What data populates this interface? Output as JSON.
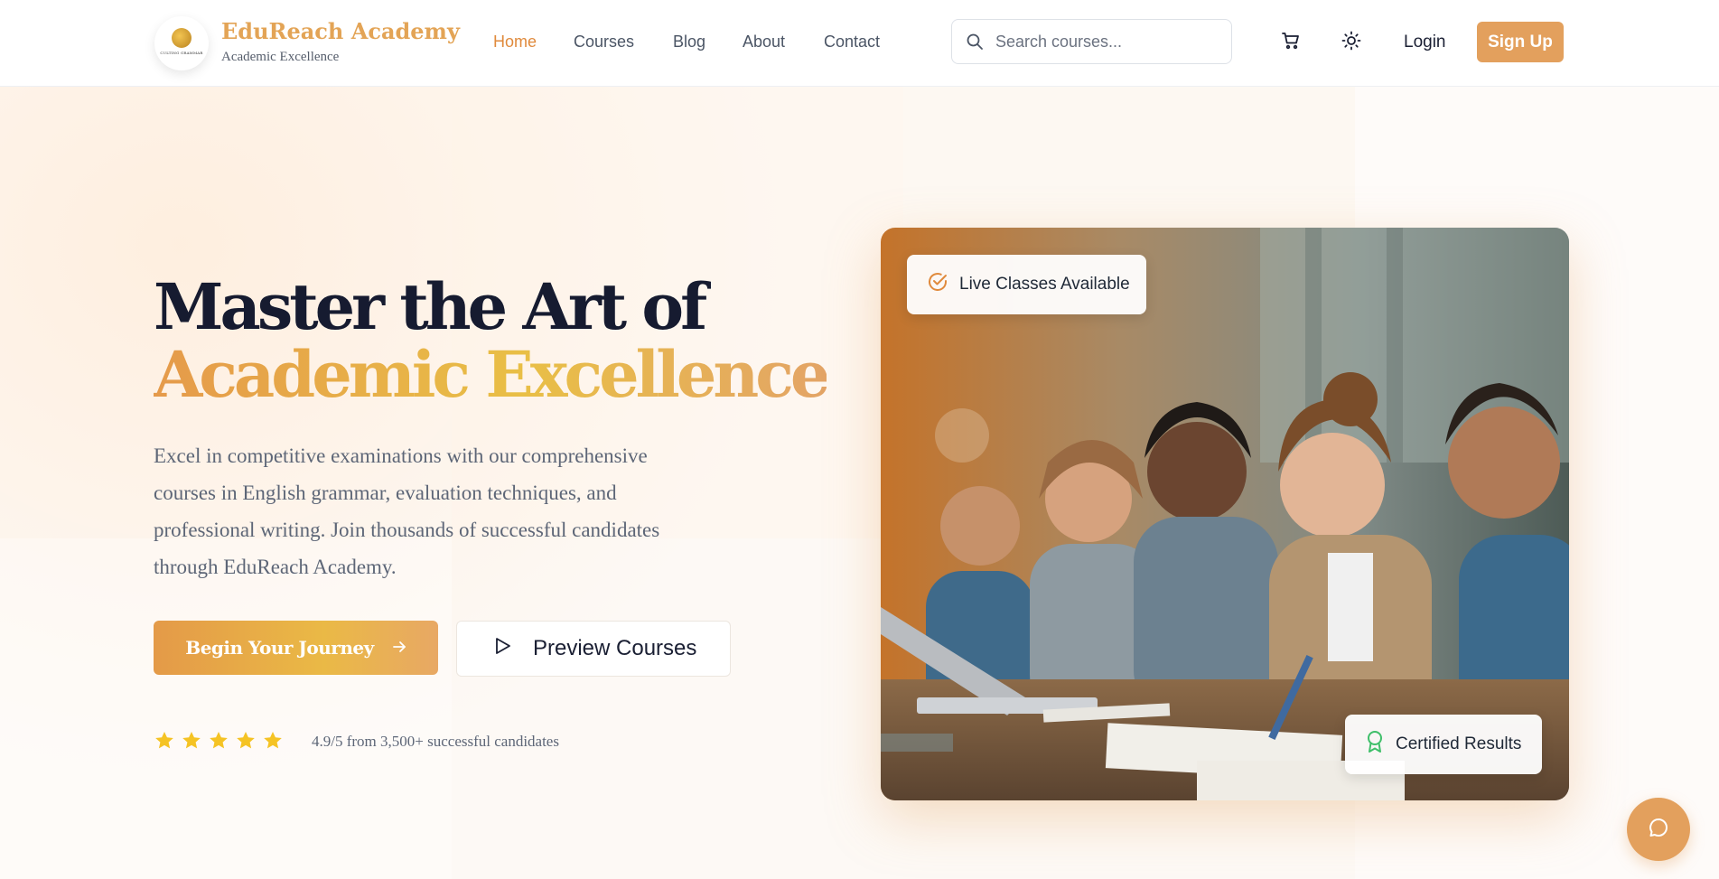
{
  "brand": {
    "name": "EduReach Academy",
    "tagline": "Academic Excellence",
    "logo_text": "CULTING GRAMMAR"
  },
  "nav": {
    "items": [
      {
        "label": "Home",
        "active": true
      },
      {
        "label": "Courses",
        "active": false
      },
      {
        "label": "Blog",
        "active": false
      },
      {
        "label": "About",
        "active": false
      },
      {
        "label": "Contact",
        "active": false
      }
    ]
  },
  "search": {
    "placeholder": "Search courses...",
    "icon": "search-icon"
  },
  "header_actions": {
    "cart_icon": "cart-icon",
    "theme_icon": "sun-icon",
    "login_label": "Login",
    "signup_label": "Sign Up"
  },
  "hero": {
    "title_line1": "Master the Art of",
    "title_line2": "Academic Excellence",
    "description": "Excel in competitive examinations with our comprehensive courses in English grammar, evaluation techniques, and professional writing. Join thousands of successful candidates through EduReach Academy.",
    "primary_cta": "Begin Your Journey",
    "secondary_cta": "Preview Courses",
    "rating_stars": 5,
    "rating_text": "4.9/5 from 3,500+ successful candidates",
    "badge_top": "Live Classes Available",
    "badge_bottom": "Certified Results"
  },
  "colors": {
    "accent": "#e3a05d",
    "accent_text": "#e08a3c",
    "heading": "#161b30",
    "star": "#f5c324",
    "certified_icon": "#3fbf6a"
  }
}
